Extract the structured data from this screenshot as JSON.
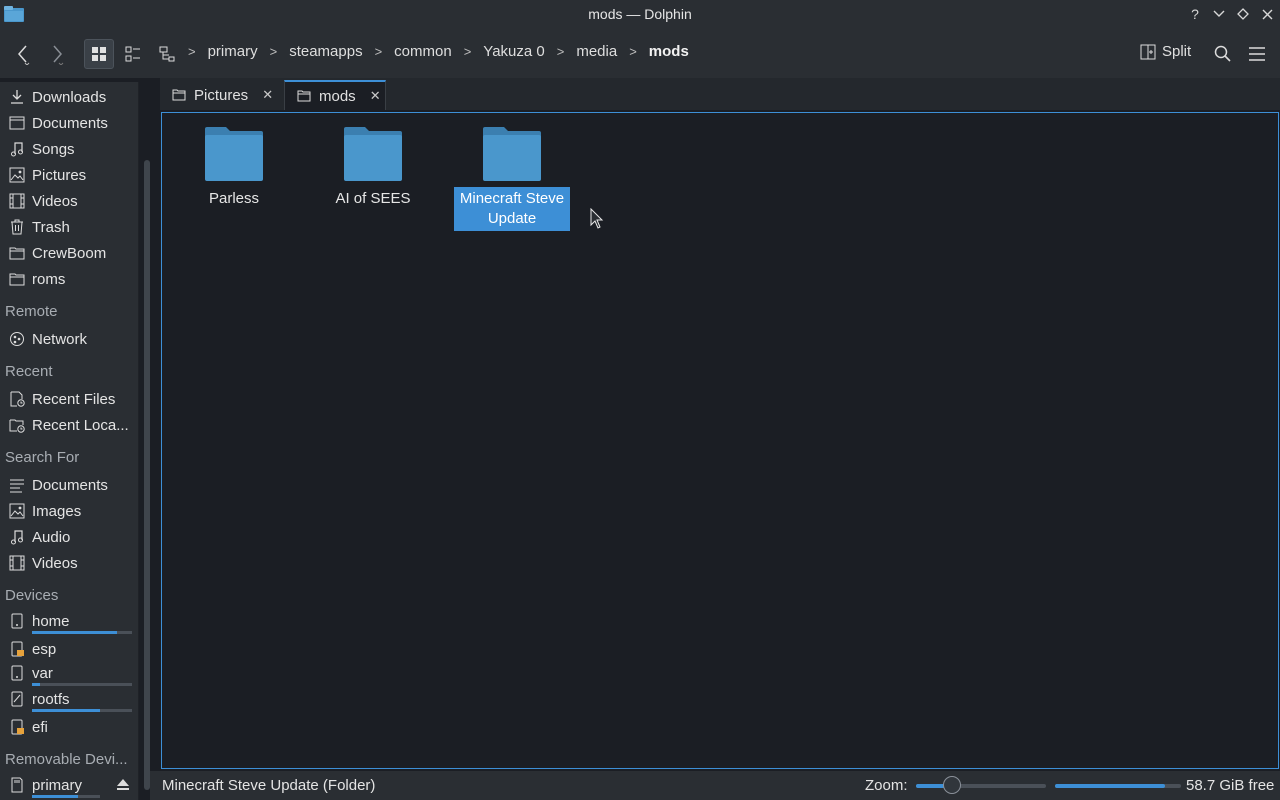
{
  "window": {
    "title": "mods — Dolphin"
  },
  "window_buttons": [
    "help-icon",
    "minimize-icon",
    "keep-above-icon",
    "close-icon"
  ],
  "breadcrumb": [
    "primary",
    "steamapps",
    "common",
    "Yakuza 0",
    "media",
    "mods"
  ],
  "toolbar": {
    "split_label": "Split"
  },
  "sidebar": {
    "places": [
      {
        "label": "Downloads",
        "icon": "download-icon"
      },
      {
        "label": "Documents",
        "icon": "document-icon"
      },
      {
        "label": "Songs",
        "icon": "music-icon"
      },
      {
        "label": "Pictures",
        "icon": "image-icon"
      },
      {
        "label": "Videos",
        "icon": "video-icon"
      },
      {
        "label": "Trash",
        "icon": "trash-icon"
      },
      {
        "label": "CrewBoom",
        "icon": "folder-icon"
      },
      {
        "label": "roms",
        "icon": "folder-icon"
      }
    ],
    "remote_heading": "Remote",
    "remote": [
      {
        "label": "Network",
        "icon": "network-icon"
      }
    ],
    "recent_heading": "Recent",
    "recent": [
      {
        "label": "Recent Files",
        "icon": "recent-files-icon"
      },
      {
        "label": "Recent Loca...",
        "icon": "recent-locations-icon"
      }
    ],
    "search_heading": "Search For",
    "search": [
      {
        "label": "Documents",
        "icon": "document-list-icon"
      },
      {
        "label": "Images",
        "icon": "image-icon"
      },
      {
        "label": "Audio",
        "icon": "music-icon"
      },
      {
        "label": "Videos",
        "icon": "video-icon"
      }
    ],
    "devices_heading": "Devices",
    "devices": [
      {
        "label": "home",
        "icon": "drive-icon",
        "usage": 0.85
      },
      {
        "label": "esp",
        "icon": "drive-locked-icon"
      },
      {
        "label": "var",
        "icon": "drive-icon",
        "usage": 0.08
      },
      {
        "label": "rootfs",
        "icon": "drive-locked-icon",
        "usage": 0.68
      },
      {
        "label": "efi",
        "icon": "drive-locked-icon"
      }
    ],
    "removable_heading": "Removable Devi...",
    "removable": [
      {
        "label": "primary",
        "icon": "sdcard-icon",
        "usage": 0.68
      }
    ]
  },
  "tabs": [
    {
      "label": "Pictures",
      "selected": false
    },
    {
      "label": "mods",
      "selected": true
    }
  ],
  "files": [
    {
      "name": "Parless",
      "type": "folder",
      "selected": false
    },
    {
      "name": "AI of SEES",
      "type": "folder",
      "selected": false
    },
    {
      "name": "Minecraft Steve Update",
      "type": "folder",
      "selected": true
    }
  ],
  "statusbar": {
    "text": "Minecraft Steve Update (Folder)",
    "zoom_label": "Zoom:",
    "zoom_level": 0.28,
    "space_used": 0.87,
    "space_free": "58.7 GiB free"
  },
  "colors": {
    "accent": "#3d8fd6",
    "folder": "#4a97cc",
    "background": "#1b1e24",
    "panel": "#2a2e33"
  }
}
